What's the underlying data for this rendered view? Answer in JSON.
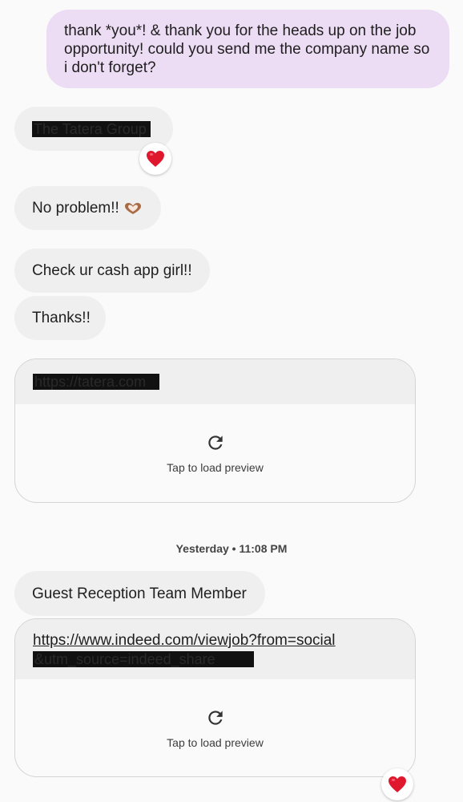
{
  "messages": {
    "outgoing_1": "thank *you*! & thank you for the heads up on the job opportunity! could you send me the company name so i don't forget?",
    "incoming_company_redacted": "The Tatera Group",
    "incoming_no_problem": "No problem!!",
    "incoming_check_cashapp": "Check ur cash app girl!!",
    "incoming_thanks": "Thanks!!",
    "link_card_1_url_redacted": "https://tatera.com",
    "link_card_1_preview": "Tap to load preview",
    "timestamp": "Yesterday • 11:08 PM",
    "incoming_job_title": "Guest Reception Team Member",
    "link_card_2_url": "https://www.indeed.com/viewjob?from=social",
    "link_card_2_url_line2_redacted": "&utm_source=indeed_share",
    "link_card_2_preview": "Tap to load preview"
  },
  "reactions": {
    "company_message": "heart-emoji",
    "link_card_2": "heart-emoji"
  },
  "colors": {
    "outgoing_bubble": "#ecdcf4",
    "incoming_bubble": "#efefef",
    "background": "#fafafa",
    "reaction_heart": "#e0182d"
  }
}
